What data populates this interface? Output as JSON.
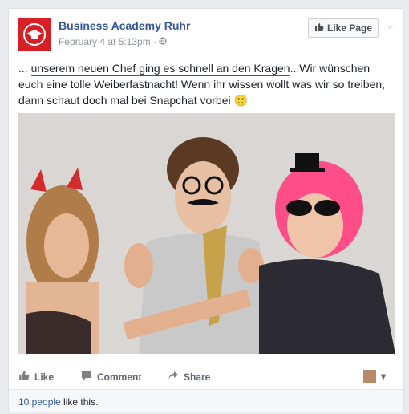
{
  "post": {
    "page_name": "Business Academy Ruhr",
    "timestamp": "February 4 at 5:13pm",
    "privacy_separator": "·",
    "like_page_label": "Like Page",
    "text_prefix": "... ",
    "text_underlined": "unserem neuen Chef ging es schnell an den Kragen",
    "text_rest": "...Wir wünschen euch eine tolle Weiberfastnacht! Wenn ihr wissen wollt was wir so treiben, dann schaut doch mal bei Snapchat vorbei",
    "emoji": "🙂"
  },
  "actions": {
    "like": "Like",
    "comment": "Comment",
    "share": "Share"
  },
  "footer": {
    "likes_count": "10 people",
    "likes_suffix": " like this."
  },
  "colors": {
    "brand": "#d81f26",
    "link": "#365899"
  }
}
